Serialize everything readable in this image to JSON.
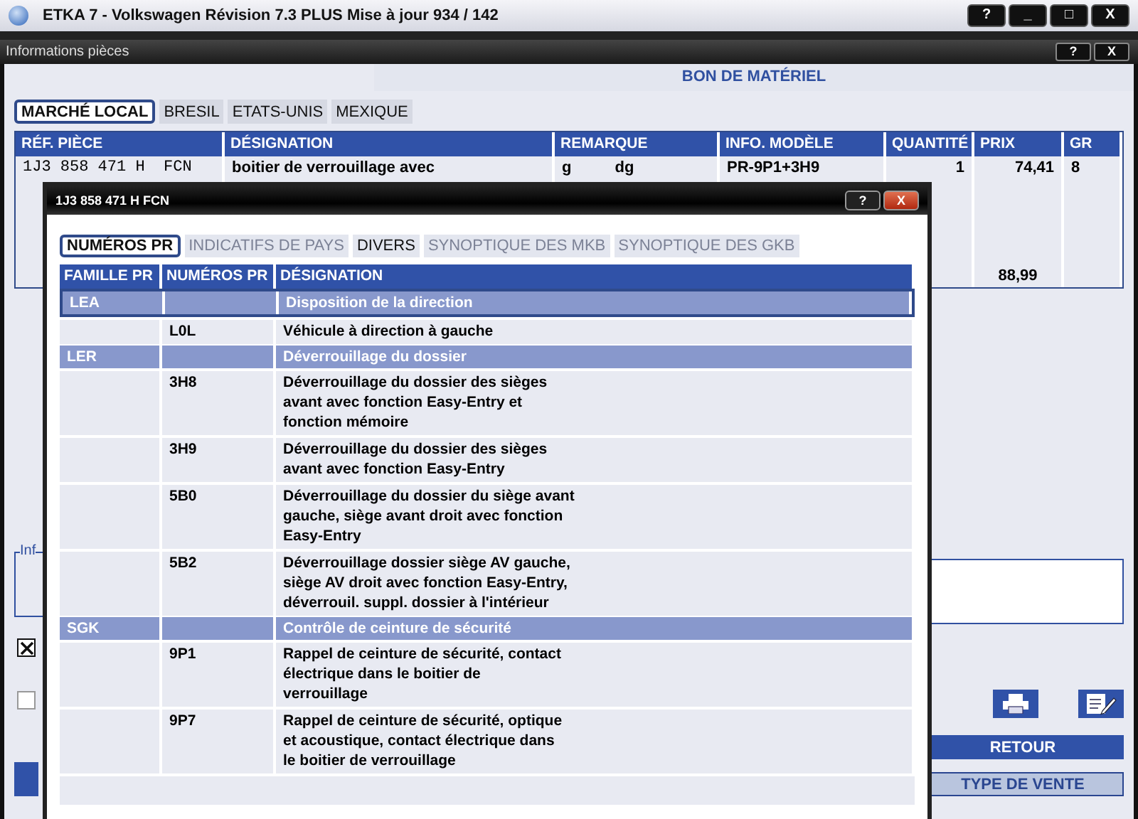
{
  "window": {
    "title": "ETKA 7 - Volkswagen Révision 7.3 PLUS Mise à jour 934 / 142",
    "controls": [
      "?",
      "_",
      "□",
      "X"
    ]
  },
  "panel": {
    "title": "Informations pièces",
    "controls": [
      "?",
      "X"
    ],
    "heading": "BON DE MATÉRIEL"
  },
  "market_tabs": [
    {
      "label": "MARCHÉ LOCAL",
      "selected": true
    },
    {
      "label": "BRESIL",
      "selected": false
    },
    {
      "label": "ETATS-UNIS",
      "selected": false
    },
    {
      "label": "MEXIQUE",
      "selected": false
    }
  ],
  "parts_table": {
    "columns": [
      "RÉF. PIÈCE",
      "DÉSIGNATION",
      "REMARQUE",
      "INFO. MODÈLE",
      "QUANTITÉ",
      "PRIX",
      "GR"
    ],
    "rows": [
      [
        "1J3 858 471 H  FCN",
        "boitier de verrouillage avec",
        "g          dg",
        "PR-9P1+3H9",
        "1",
        "74,41",
        "8"
      ]
    ],
    "total": "88,99"
  },
  "info_group": {
    "label": "Inf"
  },
  "checkboxes": [
    {
      "checked": true
    },
    {
      "checked": false
    }
  ],
  "actions": {
    "buttons": [
      "RETOUR",
      "TYPE DE VENTE"
    ]
  },
  "dialog": {
    "title": "1J3 858 471 H  FCN",
    "controls": [
      "?",
      "X"
    ],
    "tabs": [
      {
        "label": "NUMÉROS PR",
        "selected": true,
        "disabled": false
      },
      {
        "label": "INDICATIFS DE PAYS",
        "selected": false,
        "disabled": true
      },
      {
        "label": "DIVERS",
        "selected": false,
        "disabled": false
      },
      {
        "label": "SYNOPTIQUE DES MKB",
        "selected": false,
        "disabled": true
      },
      {
        "label": "SYNOPTIQUE DES GKB",
        "selected": false,
        "disabled": true
      }
    ],
    "table": {
      "columns": [
        "FAMILLE PR",
        "NUMÉROS PR",
        "DÉSIGNATION"
      ],
      "rows": [
        {
          "kind": "family",
          "family": "LEA",
          "designation": "Disposition de la direction",
          "selected": true
        },
        {
          "kind": "option",
          "code": "L0L",
          "designation": [
            "Véhicule à direction à gauche"
          ]
        },
        {
          "kind": "family",
          "family": "LER",
          "designation": "Déverrouillage du dossier",
          "selected": false
        },
        {
          "kind": "option",
          "code": "3H8",
          "designation": [
            "Déverrouillage du dossier des sièges",
            "avant avec fonction Easy-Entry et",
            "fonction mémoire"
          ]
        },
        {
          "kind": "option",
          "code": "3H9",
          "designation": [
            "Déverrouillage du dossier des sièges",
            "avant avec fonction Easy-Entry"
          ]
        },
        {
          "kind": "option",
          "code": "5B0",
          "designation": [
            "Déverrouillage du dossier du siège avant",
            "gauche, siège avant droit avec fonction",
            "Easy-Entry"
          ]
        },
        {
          "kind": "option",
          "code": "5B2",
          "designation": [
            "Déverrouillage dossier siège AV gauche,",
            "siège AV droit avec fonction Easy-Entry,",
            "déverrouil. suppl. dossier à l'intérieur"
          ]
        },
        {
          "kind": "family",
          "family": "SGK",
          "designation": "Contrôle de ceinture de sécurité",
          "selected": false
        },
        {
          "kind": "option",
          "code": "9P1",
          "designation": [
            "Rappel de ceinture de sécurité, contact",
            "électrique dans le boitier de",
            "verrouillage"
          ]
        },
        {
          "kind": "option",
          "code": "9P7",
          "designation": [
            "Rappel de ceinture de sécurité, optique",
            "et acoustique, contact électrique dans",
            "le boitier de verrouillage"
          ]
        }
      ]
    }
  }
}
